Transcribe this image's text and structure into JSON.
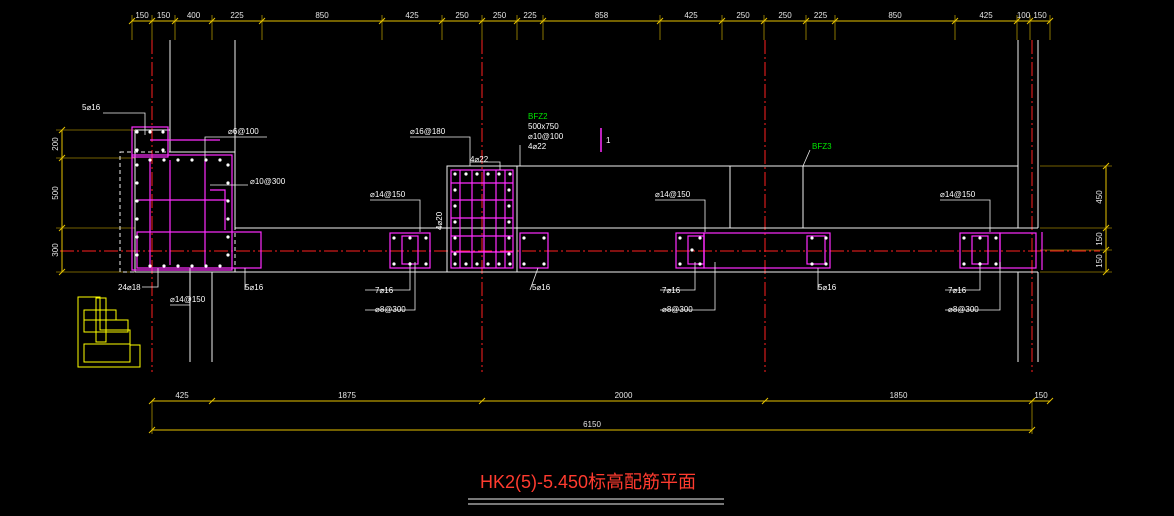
{
  "drawing": {
    "title": "HK2(5)-5.450标高配筋平面",
    "colors": {
      "background": "#000000",
      "dimension": "#e6c200",
      "wall": "#ffffff",
      "rebar": "#ff2cff",
      "axis": "#ff2020",
      "label": "#ffffff",
      "green_label": "#00e600",
      "title": "#ff3b2f",
      "detail": "#ffff00"
    },
    "top_dimensions": [
      "150",
      "150",
      "400",
      "225",
      "850",
      "425",
      "250",
      "250",
      "225",
      "858",
      "425",
      "250",
      "250",
      "225",
      "850",
      "425",
      "100",
      "150"
    ],
    "left_dimensions": [
      "200",
      "500",
      "300"
    ],
    "right_dimensions": [
      "450",
      "150",
      "150"
    ],
    "bottom_dimensions": [
      "425",
      "1875",
      "2000",
      "1850",
      "150"
    ],
    "total_dimension": "6150",
    "section_marker": "1",
    "labels": {
      "l1": "5⌀16",
      "l2": "⌀6@100",
      "l3": "⌀16@180",
      "l4": "4⌀22",
      "l5": "⌀10@300",
      "l6": "⌀14@150",
      "l7": "4⌀20",
      "l8": "24⌀18",
      "l9": "⌀14@150",
      "l10": "5⌀16",
      "l11": "7⌀16",
      "l12": "⌀8@300",
      "l13": "5⌀16",
      "l14": "⌀14@150",
      "l15": "7⌀16",
      "l16": "⌀8@300",
      "l17": "5⌀16",
      "l18": "⌀14@150",
      "l19": "7⌀16",
      "l20": "⌀8@300"
    },
    "column_labels": {
      "bfz2_name": "BFZ2",
      "bfz2_size": "500x750",
      "bfz2_stirrup": "⌀10@100",
      "bfz2_main": "4⌀22",
      "bfz3_name": "BFZ3"
    }
  }
}
